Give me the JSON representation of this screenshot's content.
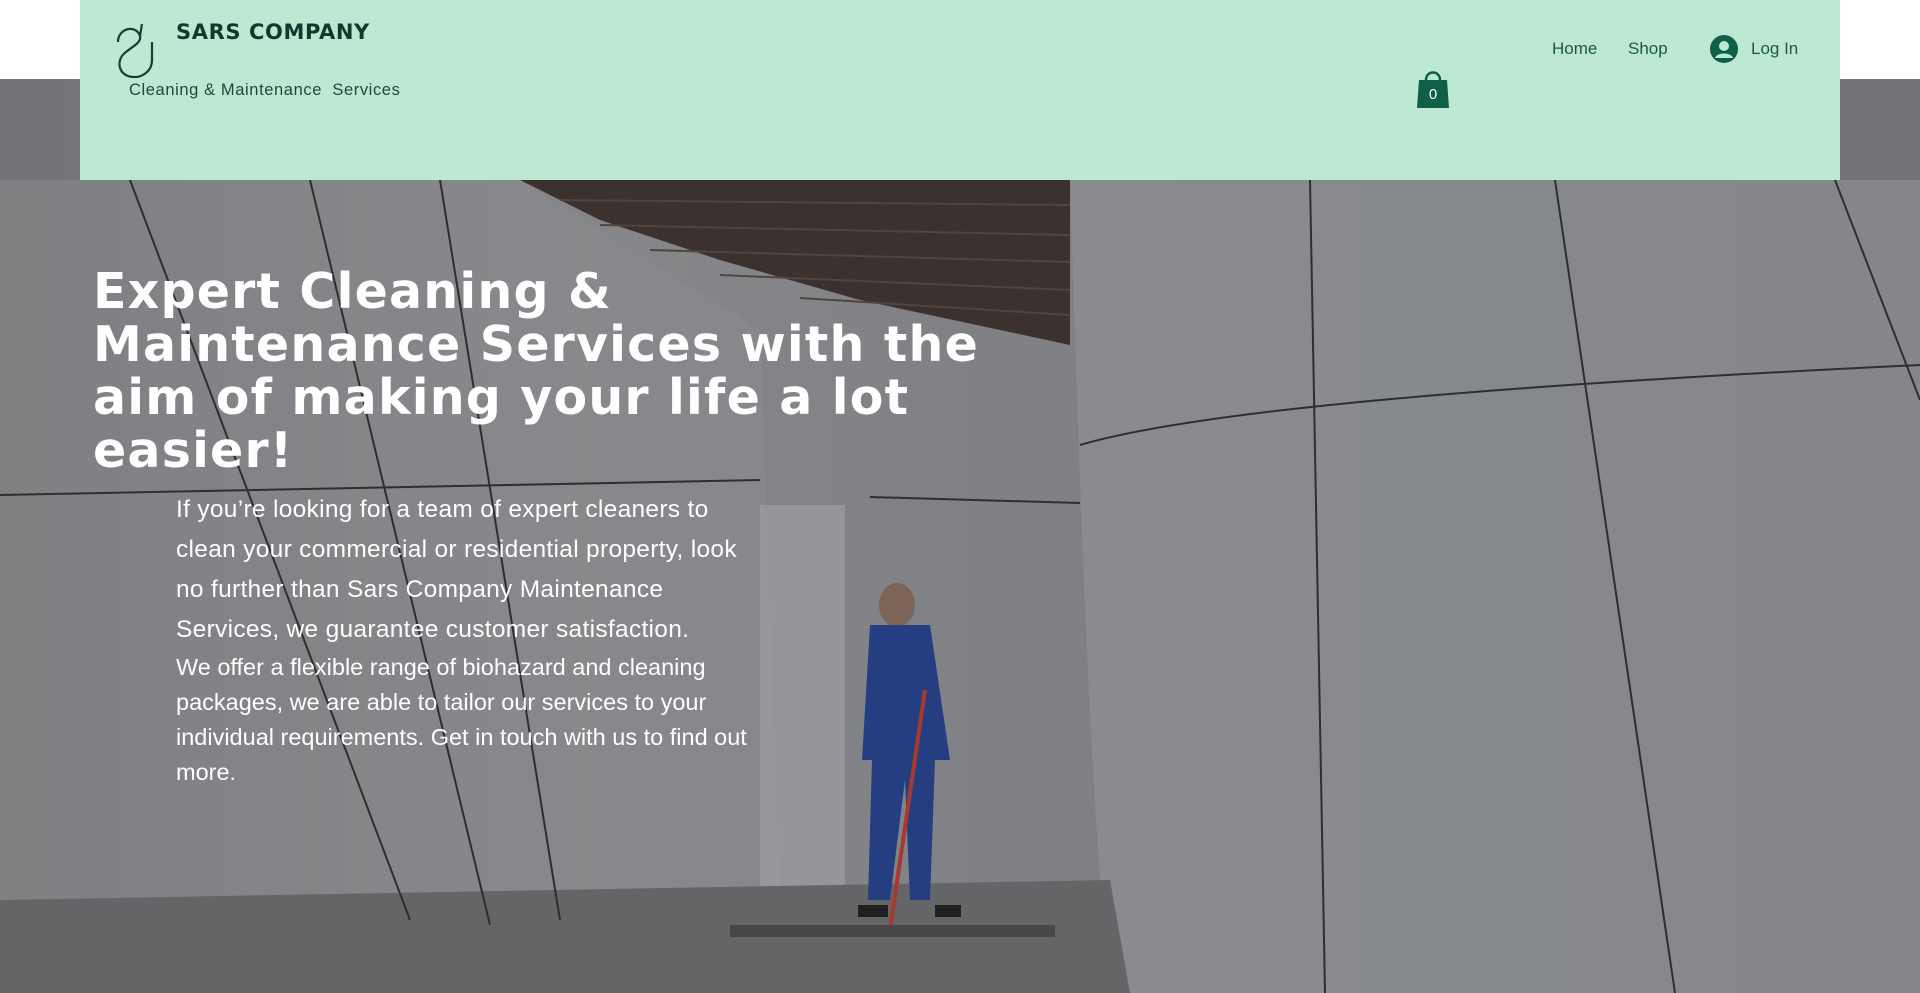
{
  "header": {
    "brand": "SARS COMPANY",
    "tagline": "Cleaning & Maintenance  Services",
    "cart_count": "0",
    "nav": [
      {
        "label": "Home"
      },
      {
        "label": "Shop"
      }
    ],
    "login_label": "Log In"
  },
  "hero": {
    "headline": "Expert Cleaning & Maintenance Services with the aim of making your life a lot easier!",
    "paragraph1": "If you’re looking for a team of expert cleaners to clean your commercial or residential property, look no further than Sars Company Maintenance Services, we guarantee customer satisfaction.",
    "paragraph2": "We offer a flexible range of biohazard and  cleaning packages, we are able to tailor our services to your individual requirements. Get in touch with us to find out more."
  },
  "colors": {
    "header_bg": "#bde8d1",
    "accent_dark": "#0f5e48",
    "text_on_hero": "#ffffff"
  },
  "icons": {
    "logo": "leaf-logo-icon",
    "cart": "shopping-bag-icon",
    "avatar": "user-avatar-icon"
  }
}
